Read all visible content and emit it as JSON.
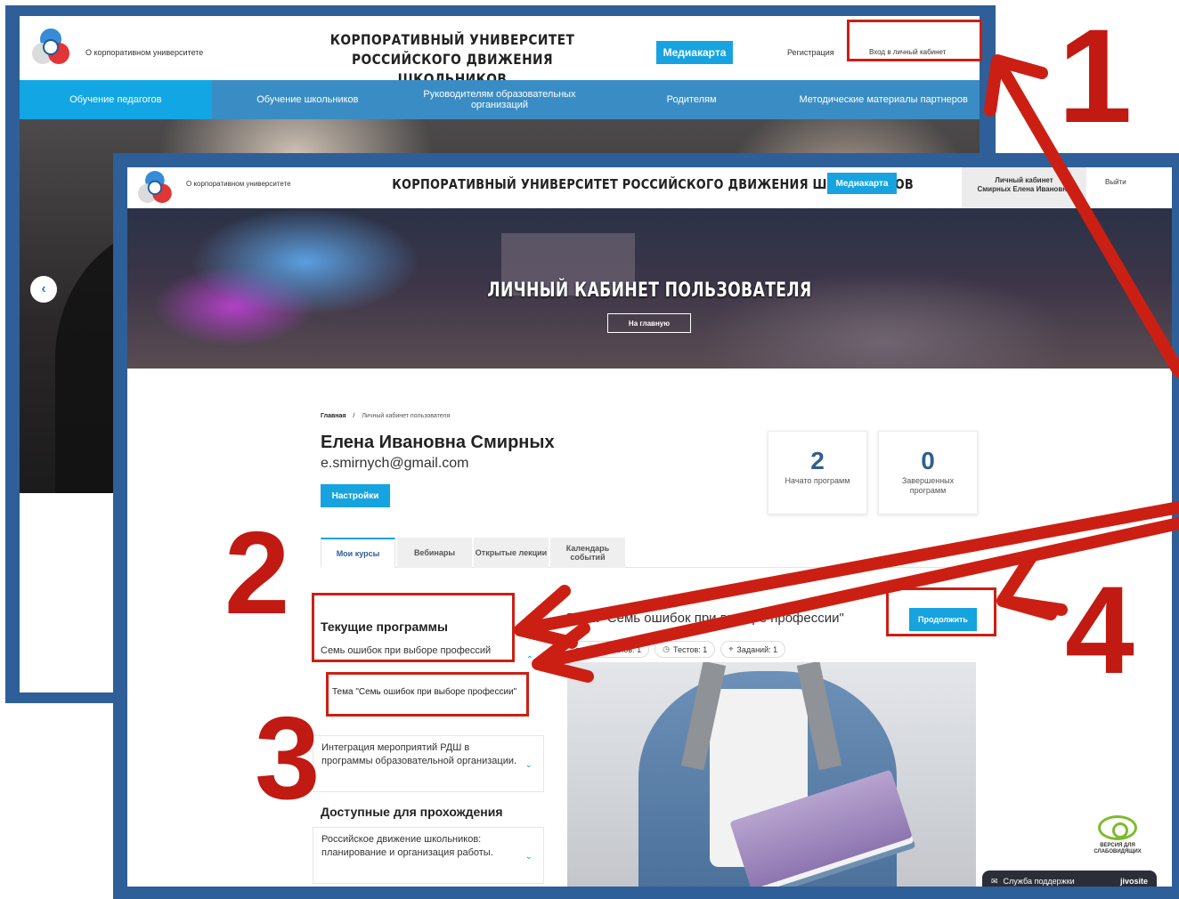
{
  "back": {
    "about_link": "О корпоративном университете",
    "title_line1": "Корпоративный университет Российского движения",
    "title_line2": "школьников",
    "media_button": "Медиакарта",
    "register_link": "Регистрация",
    "login_link": "Вход в личный кабинет",
    "nav": [
      {
        "label": "Обучение педагогов",
        "active": true
      },
      {
        "label": "Обучение школьников",
        "active": false
      },
      {
        "label": "Руководителям образовательных организаций",
        "active": false
      },
      {
        "label": "Родителям",
        "active": false
      },
      {
        "label": "Методические материалы партнеров",
        "active": false
      }
    ],
    "prev_icon": "‹"
  },
  "front": {
    "about_link": "О корпоративном университете",
    "title": "Корпоративный университет Российского движения школьников",
    "media_button": "Медиакарта",
    "cabinet_label": "Личный кабинет",
    "cabinet_user": "Смирных Елена Ивановна",
    "exit_link": "Выйти",
    "hero_title": "Личный кабинет пользователя",
    "hero_button": "На главную",
    "breadcrumb": {
      "home": "Главная",
      "sep": "/",
      "current": "Личный кабинет пользователя"
    },
    "user_name": "Елена Ивановна Смирных",
    "user_email": "e.smirnych@gmail.com",
    "settings_button": "Настройки",
    "stats": [
      {
        "value": "2",
        "label": "Начато программ"
      },
      {
        "value": "0",
        "label": "Завершенных программ"
      }
    ],
    "tabs": [
      {
        "label": "Мои курсы",
        "active": true
      },
      {
        "label": "Вебинары",
        "active": false
      },
      {
        "label": "Открытые лекции",
        "active": false
      },
      {
        "label": "Календарь событий",
        "active": false
      }
    ],
    "current_programs_heading": "Текущие программы",
    "current_programs": [
      {
        "label": "Семь ошибок при выборе профессий",
        "chevron": "⌃"
      },
      {
        "label": "Интеграция мероприятий РДШ в программы образовательной организации.",
        "chevron": "⌄"
      }
    ],
    "sub_topic": "Тема \"Семь ошибок при выборе профессии\"",
    "available_heading": "Доступные для прохождения",
    "available_programs": [
      {
        "label": "Российское движение школьников: планирование и организация работы.",
        "chevron": "⌄"
      }
    ],
    "topic_title": "Тема \"Семь ошибок при выборе профессии\"",
    "continue_button": "Продолжить",
    "chips": [
      {
        "icon": "file-icon",
        "text": "Материалов: 1"
      },
      {
        "icon": "clock-icon",
        "text": "Тестов: 1"
      },
      {
        "icon": "task-icon",
        "text": "Заданий: 1"
      }
    ],
    "vision_label": "ВЕРСИЯ ДЛЯ СЛАБОВИДЯЩИХ",
    "support_label": "Служба поддержки",
    "support_brand": "jivosite"
  },
  "annotations": [
    "1",
    "2",
    "3",
    "4"
  ],
  "colors": {
    "accent": "#16a3e0",
    "frame": "#2e5f98",
    "annotation": "#cc1f14",
    "nav": "#3a8dc4"
  }
}
